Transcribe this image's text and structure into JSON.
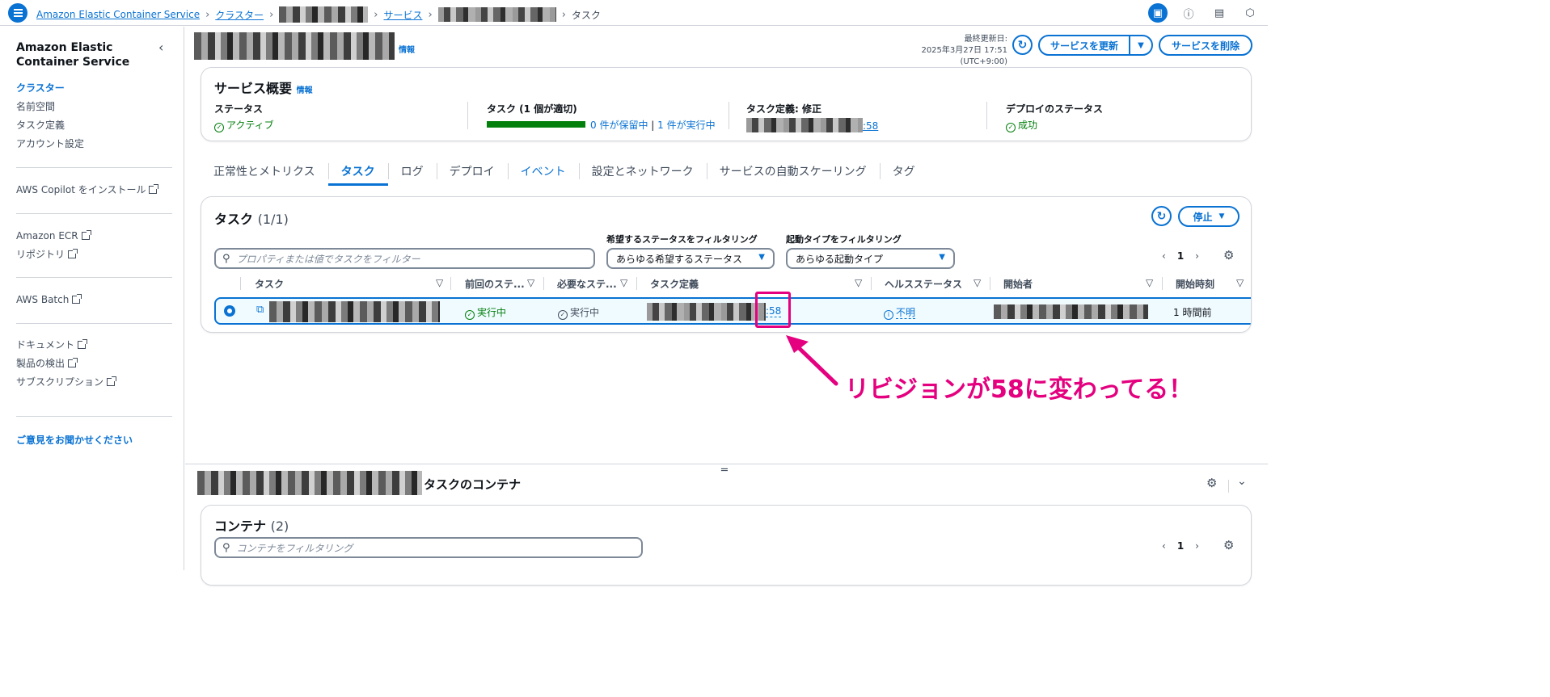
{
  "breadcrumb": {
    "service": "Amazon Elastic Container Service",
    "clusters": "クラスター",
    "services": "サービス",
    "current": "タスク"
  },
  "sidebar": {
    "title": "Amazon Elastic Container Service",
    "items": [
      "クラスター",
      "名前空間",
      "タスク定義",
      "アカウント設定"
    ],
    "copilot": "AWS Copilot をインストール",
    "ecr": "Amazon ECR",
    "repositories": "リポジトリ",
    "batch": "AWS Batch",
    "docs": "ドキュメント",
    "products": "製品の検出",
    "subscriptions": "サブスクリプション",
    "feedback": "ご意見をお聞かせください"
  },
  "header": {
    "info": "情報",
    "last_updated_label": "最終更新日:",
    "last_updated_value": "2025年3月27日 17:51 (UTC+9:00)",
    "update_service": "サービスを更新",
    "delete_service": "サービスを削除"
  },
  "overview": {
    "title": "サービス概要",
    "info": "情報",
    "status_label": "ステータス",
    "status_value": "アクティブ",
    "tasks_label": "タスク (1 個が適切)",
    "pending": "0 件が保留中",
    "running": "1 件が実行中",
    "taskdef_label": "タスク定義: 修正",
    "taskdef_rev": ":58",
    "deploy_label": "デプロイのステータス",
    "deploy_value": "成功"
  },
  "tabs": [
    "正常性とメトリクス",
    "タスク",
    "ログ",
    "デプロイ",
    "イベント",
    "設定とネットワーク",
    "サービスの自動スケーリング",
    "タグ"
  ],
  "tasks": {
    "title": "タスク",
    "count": "(1/1)",
    "stop_button": "停止",
    "search_placeholder": "プロパティまたは値でタスクをフィルター",
    "filter_status_label": "希望するステータスをフィルタリング",
    "filter_status_value": "あらゆる希望するステータス",
    "filter_launch_label": "起動タイプをフィルタリング",
    "filter_launch_value": "あらゆる起動タイプ",
    "page": "1",
    "columns": [
      "タスク",
      "前回のステ...",
      "必要なステ...",
      "タスク定義",
      "ヘルスステータス",
      "開始者",
      "開始時刻"
    ],
    "row": {
      "last_status": "実行中",
      "desired_status": "実行中",
      "taskdef_rev": ":58",
      "health": "不明",
      "started_at": "1 時間前"
    }
  },
  "annotation": "リビジョンが58に変わってる！",
  "containers_panel": {
    "title_suffix": "タスクのコンテナ",
    "card_title": "コンテナ",
    "count": "(2)",
    "search_placeholder": "コンテナをフィルタリング",
    "page": "1"
  },
  "colors": {
    "accent": "#0972d3",
    "success": "#037f0c",
    "annotation": "#e4007f"
  }
}
